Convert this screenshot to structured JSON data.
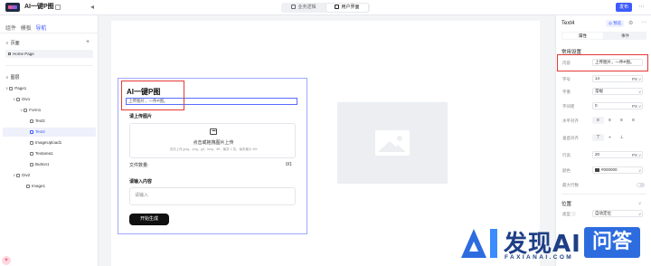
{
  "app": {
    "title": "AI一键P图",
    "publish_label": "发布",
    "mode_tabs": [
      "业务逻辑",
      "用户界面"
    ],
    "active_mode": "用户界面"
  },
  "left_panel": {
    "tabs": [
      "组件",
      "模板",
      "导航"
    ],
    "active_tab": "导航",
    "pages_heading": "页面",
    "page_item": "Home Page",
    "layers_heading": "图层",
    "tree": [
      {
        "label": "Page1",
        "depth": 0,
        "selected": false
      },
      {
        "label": "Div1",
        "depth": 1,
        "selected": false
      },
      {
        "label": "Form1",
        "depth": 2,
        "selected": false
      },
      {
        "label": "Text2",
        "depth": 3,
        "selected": false
      },
      {
        "label": "Text4",
        "depth": 3,
        "selected": true
      },
      {
        "label": "ImageUpload1",
        "depth": 3,
        "selected": false
      },
      {
        "label": "Textarea1",
        "depth": 3,
        "selected": false
      },
      {
        "label": "Button1",
        "depth": 3,
        "selected": false
      },
      {
        "label": "Div2",
        "depth": 1,
        "selected": false
      },
      {
        "label": "Image1",
        "depth": 2,
        "selected": false
      }
    ]
  },
  "canvas": {
    "form_title": "AI一键P图",
    "text4_value": "上传图片，一件P图。",
    "upload_label": "请上传图片",
    "upload_main": "点击或拖拽图片上传",
    "upload_hint": "支持上传 jpeg、png、gif、bmp、tiff，最多 1 张，每张最大 5M",
    "file_count_label": "文件数量:",
    "file_count_value": "0/1",
    "textarea_label": "请输入内容",
    "textarea_placeholder": "请输入",
    "submit_label": "开始生成"
  },
  "right_panel": {
    "component_name": "Text4",
    "badge": "◎ 预览",
    "segments": [
      "属性",
      "事件"
    ],
    "section_common": "常用设置",
    "props": {
      "content_label": "内容",
      "content_value": "上传图片，一件P图。",
      "fontsize_label": "字号",
      "fontsize_value": "14",
      "fontsize_unit": "PX",
      "weight_label": "字重",
      "weight_value": "常规",
      "letter_label": "字间距",
      "letter_value": "0",
      "letter_unit": "PX",
      "halign_label": "水平对齐",
      "valign_label": "垂直对齐",
      "lineheight_label": "行高",
      "lineheight_value": "20",
      "lineheight_unit": "PX",
      "color_label": "颜色",
      "color_value": "#000000",
      "maxrows_label": "最大行数"
    },
    "section_position": "位置",
    "position_type_label": "类型 ⓘ",
    "position_type_value": "自动定位"
  },
  "watermark": {
    "brand": "发现AI",
    "sub": "FAXIANAI.COM",
    "badge": "问答"
  },
  "colors": {
    "accent": "#3d5afe",
    "highlight": "#e53935"
  }
}
